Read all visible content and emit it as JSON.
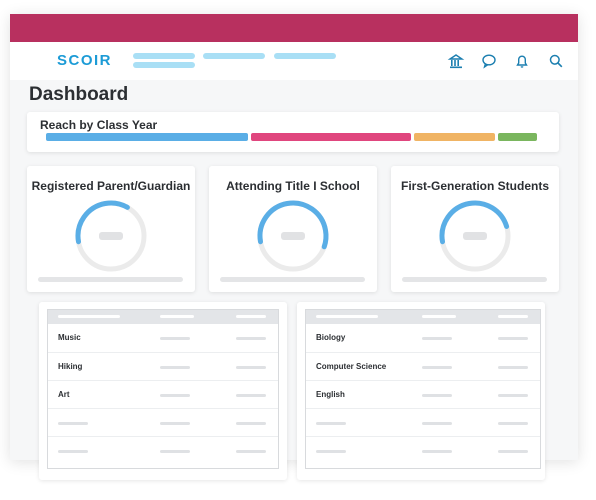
{
  "brand": {
    "logo_text": "SCOIR",
    "topbar_color": "#b8305f",
    "accent": "#1c9bd6"
  },
  "nav": {
    "icons": [
      "institution-icon",
      "chat-icon",
      "bell-icon",
      "search-icon"
    ]
  },
  "page": {
    "title": "Dashboard"
  },
  "reach": {
    "title": "Reach by Class Year",
    "segments": [
      {
        "share": 0.42,
        "color": "#5aaee6"
      },
      {
        "share": 0.33,
        "color": "#e0467e"
      },
      {
        "share": 0.17,
        "color": "#f0b464"
      },
      {
        "share": 0.08,
        "color": "#7ab65e"
      }
    ]
  },
  "stats": [
    {
      "title": "Registered Parent/Guardian",
      "fill": 0.36
    },
    {
      "title": "Attending Title I School",
      "fill": 0.58
    },
    {
      "title": "First-Generation Students",
      "fill": 0.48
    }
  ],
  "stat_colors": {
    "arc": "#5aaee6",
    "track": "#ebebeb",
    "placeholder": "#e1e2e4"
  },
  "tables": [
    {
      "rows": [
        "Music",
        "Hiking",
        "Art",
        "",
        ""
      ]
    },
    {
      "rows": [
        "Biology",
        "Computer Science",
        "English",
        "",
        ""
      ]
    }
  ]
}
